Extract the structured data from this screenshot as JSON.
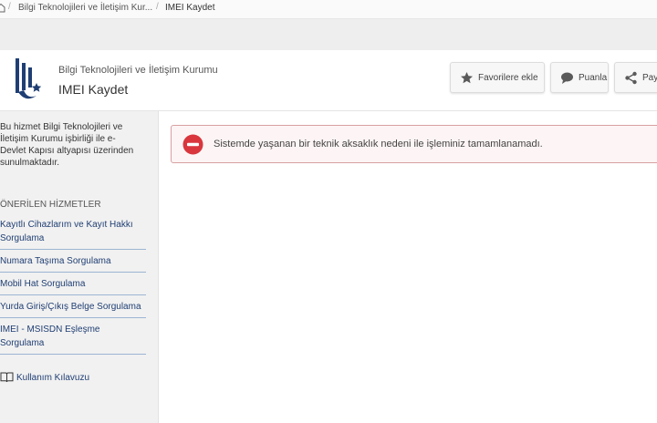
{
  "breadcrumb": {
    "items": [
      "Bilgi Teknolojileri ve İletişim Kur...",
      "IMEI Kaydet"
    ]
  },
  "header": {
    "org_name": "Bilgi Teknolojileri ve İletişim Kurumu",
    "service_title": "IMEI Kaydet",
    "buttons": {
      "favorite": "Favorilere ekle",
      "rate": "Puanla",
      "share": "Payl"
    }
  },
  "sidebar": {
    "intro": "Bu hizmet Bilgi Teknolojileri ve İletişim Kurumu işbirliği ile e-Devlet Kapısı altyapısı üzerinden sunulmaktadır.",
    "suggested_title": "ÖNERİLEN HİZMETLER",
    "links": [
      "Kayıtlı Cihazlarım ve Kayıt Hakkı Sorgulama",
      "Numara Taşıma Sorgulama",
      "Mobil Hat Sorgulama",
      "Yurda Giriş/Çıkış Belge Sorgulama",
      "IMEI - MSISDN Eşleşme Sorgulama"
    ],
    "guide": "Kullanım Kılavuzu"
  },
  "alert": {
    "message": "Sistemde yaşanan bir teknik aksaklık nedeni ile işleminiz tamamlanamadı."
  },
  "colors": {
    "link": "#1f3e73",
    "alert_icon": "#d9363e",
    "alert_border": "#d8a0a0",
    "logo": "#1f3e73"
  },
  "icons": [
    "home-icon",
    "star-icon",
    "comment-icon",
    "share-icon",
    "book-icon",
    "error-icon"
  ]
}
